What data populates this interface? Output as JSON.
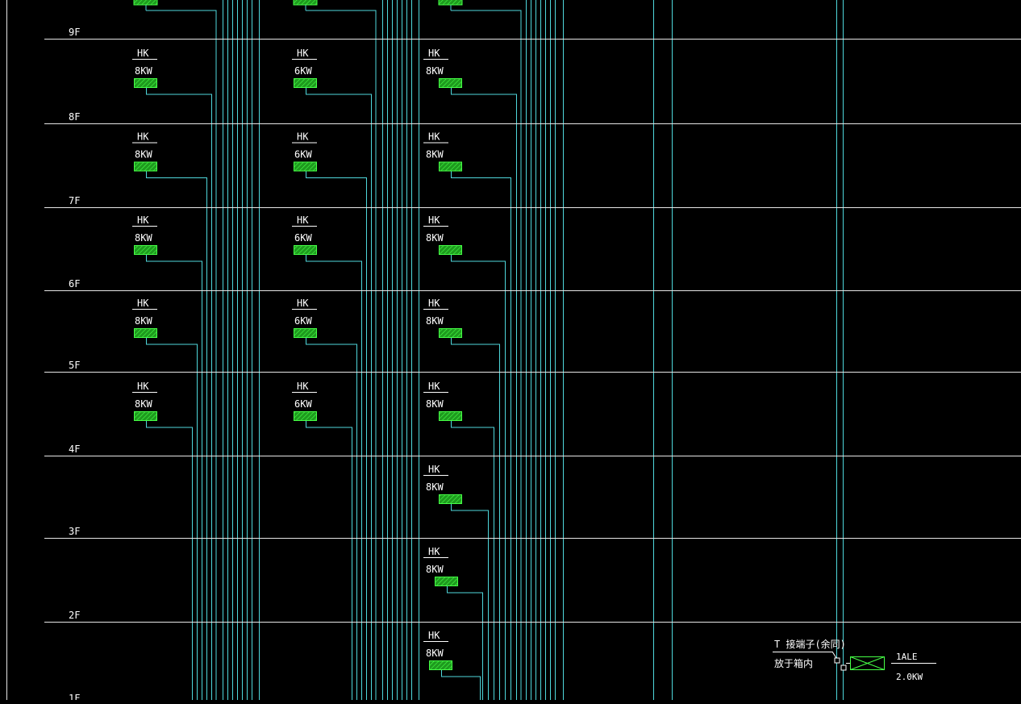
{
  "floors": [
    "9F",
    "8F",
    "7F",
    "6F",
    "5F",
    "4F",
    "3F",
    "2F",
    "1F"
  ],
  "columns": [
    {
      "label": "HK",
      "units": [
        {
          "floor": "8F",
          "power": "8KW"
        },
        {
          "floor": "7F",
          "power": "8KW"
        },
        {
          "floor": "6F",
          "power": "8KW"
        },
        {
          "floor": "5F",
          "power": "8KW"
        },
        {
          "floor": "4F",
          "power": "8KW"
        }
      ]
    },
    {
      "label": "HK",
      "units": [
        {
          "floor": "8F",
          "power": "6KW"
        },
        {
          "floor": "7F",
          "power": "6KW"
        },
        {
          "floor": "6F",
          "power": "6KW"
        },
        {
          "floor": "5F",
          "power": "6KW"
        },
        {
          "floor": "4F",
          "power": "6KW"
        }
      ]
    },
    {
      "label": "HK",
      "units": [
        {
          "floor": "8F",
          "power": "8KW"
        },
        {
          "floor": "7F",
          "power": "8KW"
        },
        {
          "floor": "6F",
          "power": "8KW"
        },
        {
          "floor": "5F",
          "power": "8KW"
        },
        {
          "floor": "4F",
          "power": "8KW"
        },
        {
          "floor": "3F",
          "power": "8KW"
        },
        {
          "floor": "2F",
          "power": "8KW"
        },
        {
          "floor": "1F",
          "power": "8KW"
        }
      ]
    }
  ],
  "legend": {
    "note_line1": "T 接端子(余同)",
    "note_line2": "放于箱内",
    "box_id": "1ALE",
    "box_power": "2.0KW"
  },
  "colors": {
    "background": "#000000",
    "wire": "#4fd8dc",
    "floor_line": "#e6e6e6",
    "box_fill": "#1e9a1e",
    "box_stroke": "#46ff46",
    "text": "#ffffff"
  }
}
